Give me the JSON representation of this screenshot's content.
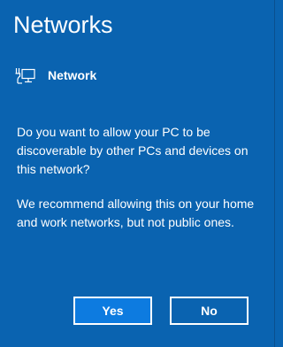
{
  "panel": {
    "title": "Networks"
  },
  "network": {
    "icon": "wired-network-icon",
    "name": "Network"
  },
  "message": {
    "question": "Do you want to allow your PC to be discoverable by other PCs and devices on this network?",
    "recommendation": "We recommend allowing this on your home and work networks, but not public ones."
  },
  "buttons": {
    "yes_label": "Yes",
    "no_label": "No"
  },
  "colors": {
    "panel_background": "#0a63b0",
    "yes_button_background": "#0d7be0",
    "text": "#ffffff"
  }
}
